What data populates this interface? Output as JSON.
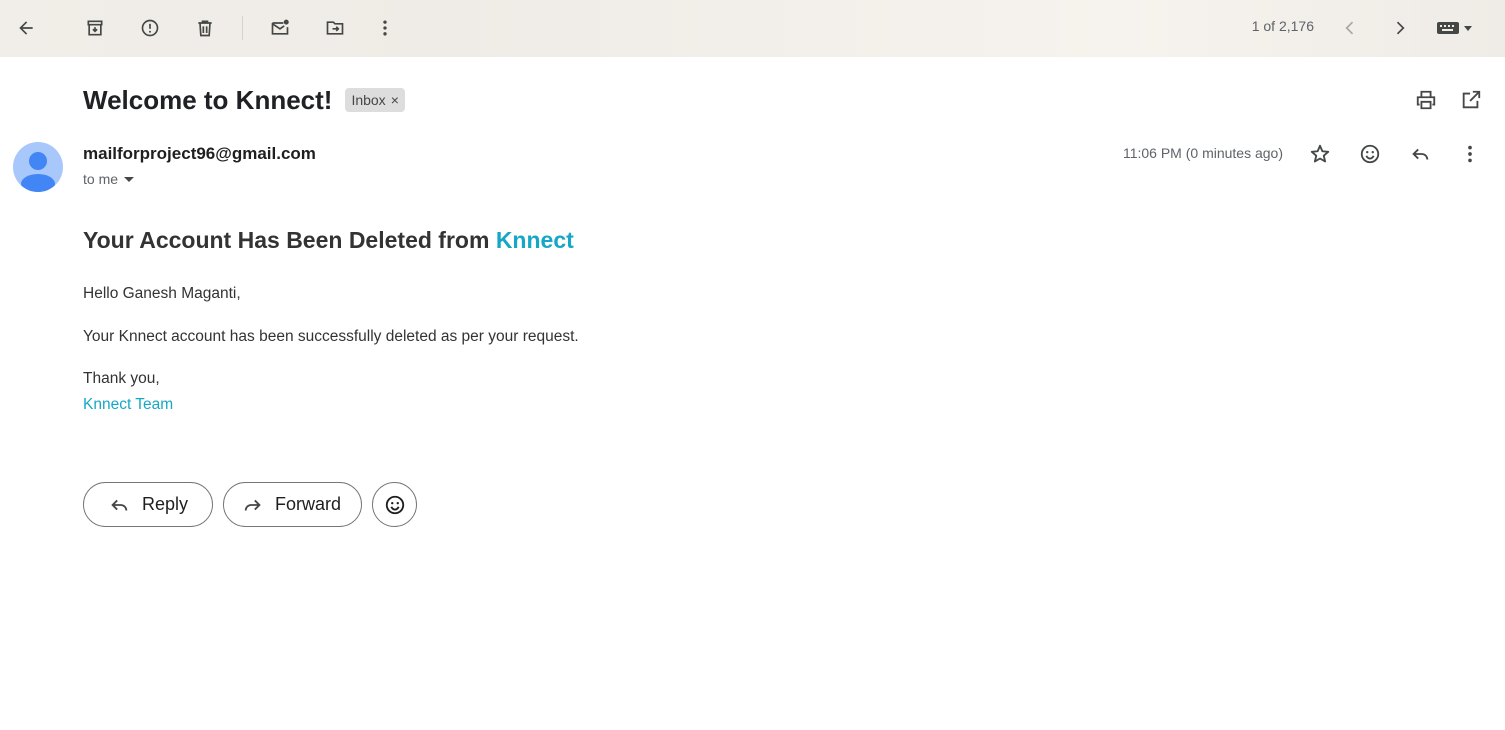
{
  "toolbar": {
    "back_icon": "arrow-left-icon",
    "archive_icon": "archive-icon",
    "report_spam_icon": "report-spam-icon",
    "delete_icon": "trash-icon",
    "mark_unread_icon": "mark-unread-icon",
    "move_to_icon": "move-to-folder-icon",
    "more_icon": "more-vertical-icon",
    "pager_text": "1 of 2,176",
    "newer_icon": "chevron-left-icon",
    "older_icon": "chevron-right-icon",
    "input_tools_icon": "keyboard-icon"
  },
  "message": {
    "subject": "Welcome to Knnect!",
    "label": "Inbox",
    "label_remove": "×",
    "sender": "mailforproject96@gmail.com",
    "recipient_text": "to me",
    "timestamp": "11:06 PM (0 minutes ago)"
  },
  "email_body": {
    "heading_prefix": "Your Account Has Been Deleted from ",
    "heading_brand": "Knnect",
    "greeting": "Hello Ganesh Maganti,",
    "paragraph": "Your Knnect account has been successfully deleted as per your request.",
    "closing": "Thank you,",
    "signature": "Knnect Team"
  },
  "actions": {
    "reply_label": "Reply",
    "forward_label": "Forward"
  },
  "colors": {
    "brand": "#17a7c6",
    "text": "#333333",
    "avatar_bg": "#a8c7fa",
    "avatar_fg": "#4285f4"
  }
}
